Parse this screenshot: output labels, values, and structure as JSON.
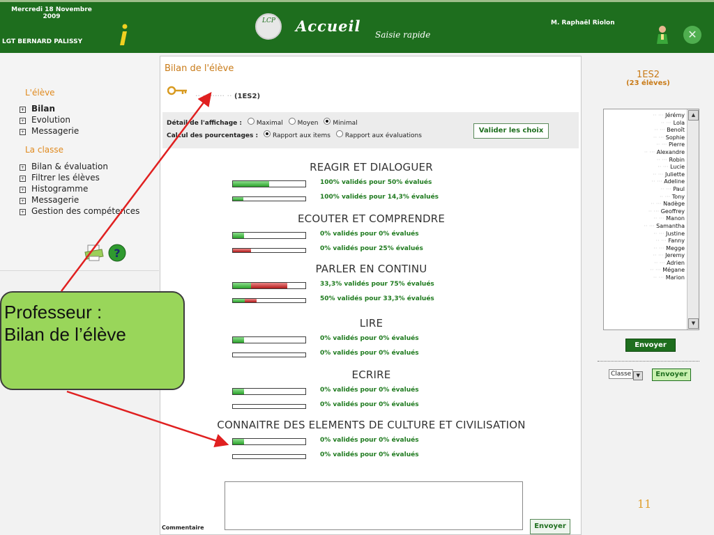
{
  "header": {
    "date_line1": "Mercredi 18 Novembre",
    "date_line2": "2009",
    "school": "LGT BERNARD PALISSY",
    "title": "Accueil",
    "subtitle": "Saisie rapide",
    "user": "M. Raphaël Riolon",
    "logo_text": "LCP",
    "icons": [
      "info-icon",
      "logo-icon",
      "person-icon",
      "close-icon"
    ]
  },
  "sidebar": {
    "section1": "L'élève",
    "eleve_items": [
      {
        "label": "Bilan",
        "bold": true
      },
      {
        "label": "Evolution"
      },
      {
        "label": "Messagerie"
      }
    ],
    "section2": "La classe",
    "classe_items": [
      {
        "label": "Bilan & évaluation"
      },
      {
        "label": "Filtrer les élèves"
      },
      {
        "label": "Histogramme"
      },
      {
        "label": "Messagerie"
      },
      {
        "label": "Gestion des compétences"
      }
    ],
    "tools": [
      "print-icon",
      "help-icon"
    ]
  },
  "main": {
    "heading": "Bilan de l'élève",
    "student_suffix": "(1ES2)",
    "options": {
      "detail_label": "Détail de l'affichage :",
      "detail_options": [
        "Maximal",
        "Moyen",
        "Minimal"
      ],
      "detail_selected": "Minimal",
      "calc_label": "Calcul des pourcentages :",
      "calc_options": [
        "Rapport aux items",
        "Rapport aux évaluations"
      ],
      "calc_selected": "Rapport aux items",
      "validate_button": "Valider les choix"
    },
    "categories": [
      {
        "name": "REAGIR ET DIALOGUER",
        "rows": [
          {
            "green": 0.5,
            "red": 0,
            "text": "100% validés pour 50% évalués"
          },
          {
            "green": 0.143,
            "red": 0,
            "text": "100% validés pour 14,3% évalués"
          }
        ]
      },
      {
        "name": "ECOUTER ET COMPRENDRE",
        "rows": [
          {
            "green": 0.15,
            "red": 0,
            "text": "0% validés pour 0% évalués"
          },
          {
            "green": 0,
            "red": 0.25,
            "text": "0% validés pour 25% évalués"
          }
        ]
      },
      {
        "name": "PARLER EN CONTINU",
        "rows": [
          {
            "green": 0.25,
            "red": 0.5,
            "text": "33,3% validés pour 75% évalués"
          },
          {
            "green": 0.167,
            "red": 0.167,
            "text": "50% validés pour 33,3% évalués"
          }
        ]
      },
      {
        "name": "LIRE",
        "rows": [
          {
            "green": 0.15,
            "red": 0,
            "text": "0% validés pour 0% évalués"
          },
          {
            "green": 0,
            "red": 0,
            "text": "0% validés pour 0% évalués"
          }
        ]
      },
      {
        "name": "ECRIRE",
        "rows": [
          {
            "green": 0.15,
            "red": 0,
            "text": "0% validés pour 0% évalués"
          },
          {
            "green": 0,
            "red": 0,
            "text": "0% validés pour 0% évalués"
          }
        ]
      },
      {
        "name": "CONNAITRE DES ELEMENTS DE CULTURE ET CIVILISATION",
        "rows": [
          {
            "green": 0.15,
            "red": 0,
            "text": "0% validés pour 0% évalués"
          },
          {
            "green": 0,
            "red": 0,
            "text": "0% validés pour 0% évalués"
          }
        ]
      }
    ],
    "comment_label": "Commentaire",
    "comment_value": "",
    "send_button": "Envoyer"
  },
  "right": {
    "class_name": "1ES2",
    "count": "(23 élèves)",
    "students": [
      "Jérémy",
      "Lola",
      "Benoît",
      "Sophie",
      "Pierre",
      "Alexandre",
      "Robin",
      "Lucie",
      "Juliette",
      "Adeline",
      "Paul",
      "Tony",
      "Nadège",
      "Geoffrey",
      "Manon",
      "Samantha",
      "Justine",
      "Fanny",
      "Megge",
      "Jeremy",
      "Adrien",
      "Mégane",
      "Marion"
    ],
    "send_button": "Envoyer",
    "class_select": "Classe",
    "send_class_button": "Envoyer"
  },
  "callout": {
    "line1": "Professeur :",
    "line2": "Bilan de l’élève"
  },
  "page_number": "11",
  "colors": {
    "header_green": "#1e6e1e",
    "accent_orange": "#c97b18",
    "bar_green": "#2aa12a",
    "bar_red": "#b01a1a",
    "callout_green": "#99d65a",
    "arrow_red": "#e02020"
  }
}
